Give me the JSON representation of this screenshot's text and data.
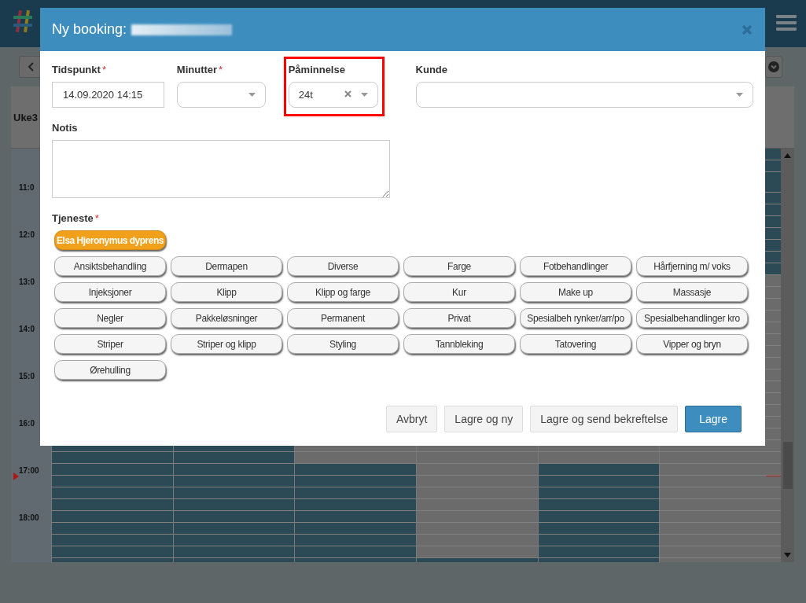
{
  "calendar": {
    "week_label": "Uke3",
    "hours": [
      {
        "cells": [
          true
        ]
      },
      {
        "label": "11:0",
        "cells": [
          true
        ]
      },
      {
        "label": "12:0",
        "cells": [
          true
        ]
      },
      {
        "label": "13:0",
        "cells": [
          false
        ]
      },
      {
        "label": "14:0",
        "cells": [
          false
        ]
      },
      {
        "label": "15:0",
        "cells": [
          false
        ]
      },
      {
        "label": "16:0",
        "cells": [
          true,
          true,
          false,
          false,
          false,
          false
        ]
      },
      {
        "label": "17:00",
        "cells": [
          true,
          true,
          true,
          false,
          true,
          false
        ]
      },
      {
        "label": "18:00",
        "cells": [
          true,
          true,
          true,
          false,
          true,
          false
        ]
      },
      {
        "cells": [
          true,
          true,
          true,
          true,
          true,
          false
        ]
      }
    ]
  },
  "dialog": {
    "title": "Ny booking:",
    "fields": [
      {
        "kind": "text",
        "label": "Tidspunkt",
        "required_mark": "*",
        "value": "14.09.2020 14:15",
        "highlighted": false
      },
      {
        "kind": "select",
        "label": "Minutter",
        "required_mark": "*",
        "highlighted": false
      },
      {
        "kind": "select",
        "label": "Påminnelse",
        "value": "24t",
        "clearable": true,
        "highlighted": true
      },
      {
        "kind": "select",
        "label": "Kunde",
        "highlighted": false
      }
    ],
    "note": {
      "label": "Notis"
    },
    "services_label": "Tjeneste",
    "services_required_mark": "*",
    "featured": {
      "label": "Elsa Hjeronymus dyprens",
      "selected": true
    },
    "services": [
      {
        "label": "Ansiktsbehandling",
        "selected": false
      },
      {
        "label": "Dermapen",
        "selected": false
      },
      {
        "label": "Diverse",
        "selected": false
      },
      {
        "label": "Farge",
        "selected": false
      },
      {
        "label": "Fotbehandlinger",
        "selected": false
      },
      {
        "label": "Hårfjerning m/ voks",
        "selected": false
      },
      {
        "label": "Injeksjoner",
        "selected": false
      },
      {
        "label": "Klipp",
        "selected": false
      },
      {
        "label": "Klipp og farge",
        "selected": false
      },
      {
        "label": "Kur",
        "selected": false
      },
      {
        "label": "Make up",
        "selected": false
      },
      {
        "label": "Massasje",
        "selected": false
      },
      {
        "label": "Negler",
        "selected": false
      },
      {
        "label": "Pakkeløsninger",
        "selected": false
      },
      {
        "label": "Permanent",
        "selected": false
      },
      {
        "label": "Privat",
        "selected": false
      },
      {
        "label": "Spesialbeh rynker/arr/po",
        "selected": false
      },
      {
        "label": "Spesialbehandlinger kro",
        "selected": false
      },
      {
        "label": "Striper",
        "selected": false
      },
      {
        "label": "Striper og klipp",
        "selected": false
      },
      {
        "label": "Styling",
        "selected": false
      },
      {
        "label": "Tannbleking",
        "selected": false
      },
      {
        "label": "Tatovering",
        "selected": false
      },
      {
        "label": "Vipper og bryn",
        "selected": false
      },
      {
        "label": "Ørehulling",
        "selected": false
      }
    ],
    "buttons": [
      {
        "label": "Avbryt",
        "kind": "default"
      },
      {
        "label": "Lagre og ny",
        "kind": "default"
      },
      {
        "label": "Lagre og send bekreftelse",
        "kind": "default"
      },
      {
        "label": "Lagre",
        "kind": "primary"
      }
    ]
  }
}
